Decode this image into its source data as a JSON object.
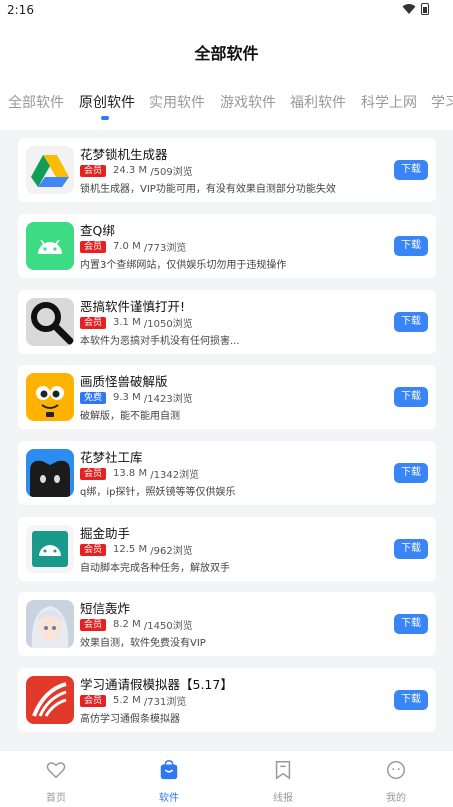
{
  "status": {
    "time": "2:16"
  },
  "header": {
    "title": "全部软件"
  },
  "tabs": [
    {
      "label": "全部软件",
      "active": false
    },
    {
      "label": "原创软件",
      "active": true
    },
    {
      "label": "实用软件",
      "active": false
    },
    {
      "label": "游戏软件",
      "active": false
    },
    {
      "label": "福利软件",
      "active": false
    },
    {
      "label": "科学上网",
      "active": false
    },
    {
      "label": "学习",
      "active": false
    }
  ],
  "apps": [
    {
      "name": "花梦锁机生成器",
      "badge": "会员",
      "size": "24.3 M",
      "views": "/509浏览",
      "desc": "锁机生成器，VIP功能可用，有没有效果自测部分功能失效",
      "download": "下载"
    },
    {
      "name": "查Q绑",
      "badge": "会员",
      "size": "7.0 M",
      "views": "/773浏览",
      "desc": "内置3个查绑网站，仅供娱乐切勿用于违规操作",
      "download": "下载"
    },
    {
      "name": "恶搞软件谨慎打开!",
      "badge": "会员",
      "size": "3.1 M",
      "views": "/1050浏览",
      "desc": "本软件为恶搞对手机没有任何损害...",
      "download": "下载"
    },
    {
      "name": "画质怪兽破解版",
      "badge": "免费",
      "size": "9.3 M",
      "views": "/1423浏览",
      "desc": "破解版，能不能用自测",
      "download": "下载"
    },
    {
      "name": "花梦社工库",
      "badge": "会员",
      "size": "13.8 M",
      "views": "/1342浏览",
      "desc": "q绑，ip探针，照妖镜等等仅供娱乐",
      "download": "下载"
    },
    {
      "name": "掘金助手",
      "badge": "会员",
      "size": "12.5 M",
      "views": "/962浏览",
      "desc": "自动脚本完成各种任务，解放双手",
      "download": "下载"
    },
    {
      "name": "短信轰炸",
      "badge": "会员",
      "size": "8.2 M",
      "views": "/1450浏览",
      "desc": "效果自测，软件免费没有VIP",
      "download": "下载"
    },
    {
      "name": "学习通请假模拟器【5.17】",
      "badge": "会员",
      "size": "5.2 M",
      "views": "/731浏览",
      "desc": "高仿学习通假条模拟器",
      "download": "下载"
    }
  ],
  "nav": [
    {
      "label": "首页",
      "icon": "heart-icon"
    },
    {
      "label": "软件",
      "icon": "bag-icon",
      "active": true
    },
    {
      "label": "线报",
      "icon": "bookmark-icon"
    },
    {
      "label": "我的",
      "icon": "smiley-icon"
    }
  ],
  "colors": {
    "accent": "#2f78f5",
    "vip_badge": "#e52121",
    "free_badge": "#2f78f5"
  }
}
